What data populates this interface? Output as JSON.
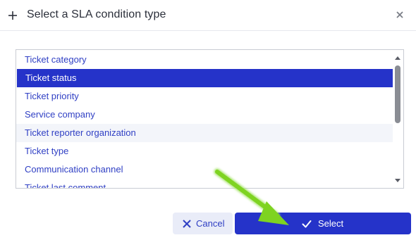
{
  "dialog": {
    "title": "Select a SLA condition type",
    "header_icon": "plus-icon",
    "close_icon": "close-icon"
  },
  "list": {
    "items": [
      {
        "label": "Ticket category",
        "selected": false
      },
      {
        "label": "Ticket status",
        "selected": true
      },
      {
        "label": "Ticket priority",
        "selected": false
      },
      {
        "label": "Service company",
        "selected": false
      },
      {
        "label": "Ticket reporter organization",
        "selected": false
      },
      {
        "label": "Ticket type",
        "selected": false
      },
      {
        "label": "Communication channel",
        "selected": false
      },
      {
        "label": "Ticket last comment",
        "selected": false
      }
    ]
  },
  "buttons": {
    "cancel_label": "Cancel",
    "cancel_icon": "close-icon",
    "select_label": "Select",
    "select_icon": "check-icon"
  },
  "colors": {
    "accent": "#2533c9",
    "link_text": "#2f3fc4",
    "cancel_bg": "#e9ecf8",
    "annotation_arrow": "#7ed321"
  }
}
